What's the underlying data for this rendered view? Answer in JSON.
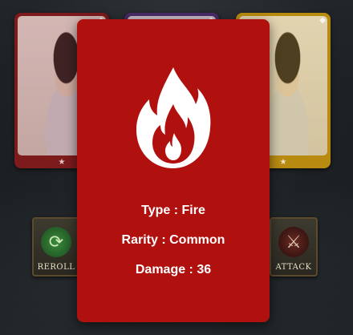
{
  "hand_cards": [
    {
      "position": "left",
      "frame_color": "#7c1a1c",
      "icon": "star-icon"
    },
    {
      "position": "middle",
      "frame_color": "#4a2a66",
      "icon": "star-icon"
    },
    {
      "position": "right",
      "frame_color": "#b88a10",
      "icon": "star-icon"
    }
  ],
  "actions": {
    "reroll_label": "REROLL",
    "attack_label": "ATTACK"
  },
  "detail_card": {
    "background_color": "#b0110f",
    "icon": "fire-icon",
    "type_text": "Type : Fire",
    "rarity_text": "Rarity : Common",
    "damage_text": "Damage : 36"
  }
}
